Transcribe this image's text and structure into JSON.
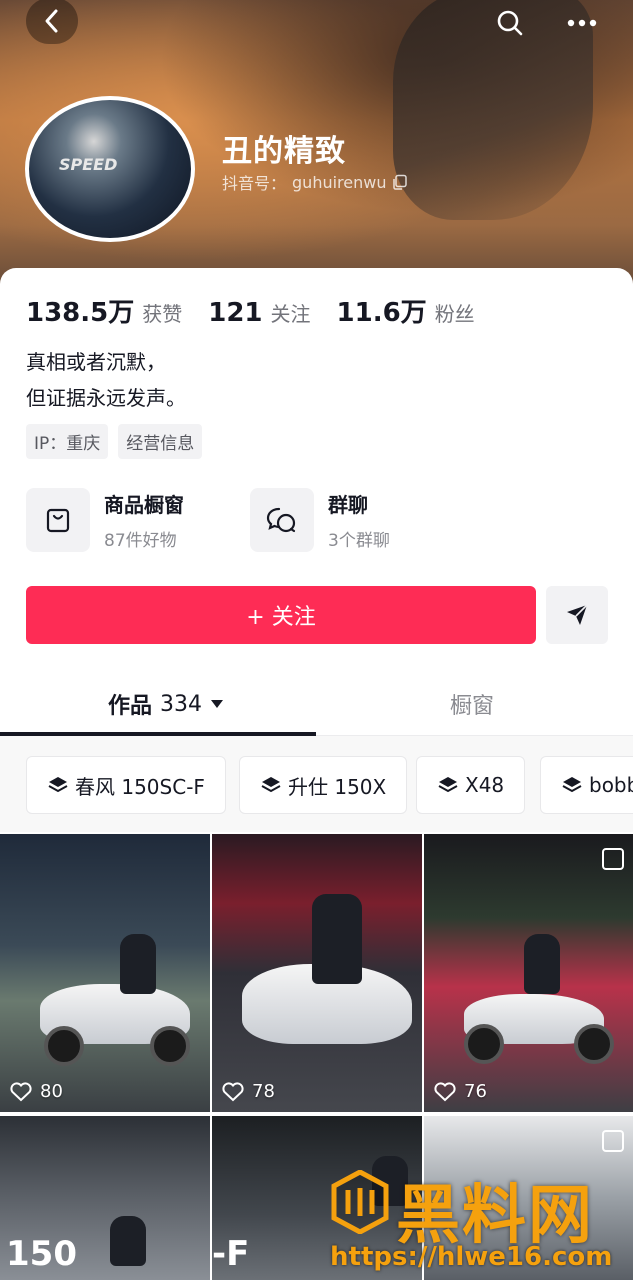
{
  "profile": {
    "name": "丑的精致",
    "handle_label": "抖音号：",
    "handle": "guhuirenwu",
    "avatar_text": "SPEED"
  },
  "stats": [
    {
      "value": "138.5万",
      "label": "获赞"
    },
    {
      "value": "121",
      "label": "关注"
    },
    {
      "value": "11.6万",
      "label": "粉丝"
    }
  ],
  "bio": {
    "line1": "真相或者沉默，",
    "line2": "但证据永远发声。"
  },
  "tags": [
    "IP：重庆",
    "经营信息"
  ],
  "services": [
    {
      "title": "商品橱窗",
      "sub": "87件好物",
      "icon": "shopping-bag-icon"
    },
    {
      "title": "群聊",
      "sub": "3个群聊",
      "icon": "chat-bubbles-icon"
    }
  ],
  "actions": {
    "follow_label": "+ 关注",
    "share_icon": "send-icon"
  },
  "tabs": {
    "works_label": "作品",
    "works_count": "334",
    "window_label": "橱窗"
  },
  "collections": [
    "春风 150SC-F",
    "升仕 150X",
    "X48",
    "bobb"
  ],
  "videos": [
    {
      "likes": "80"
    },
    {
      "likes": "78"
    },
    {
      "likes": "76"
    },
    {
      "overlay_text": "150"
    },
    {
      "overlay_text": "-F"
    },
    {}
  ],
  "watermark": {
    "text": "黑料网",
    "url": "https://hlwe16.com"
  },
  "colors": {
    "accent": "#fe2c55",
    "text_primary": "#161823",
    "text_secondary": "#73747b",
    "watermark": "#f5a10e"
  }
}
